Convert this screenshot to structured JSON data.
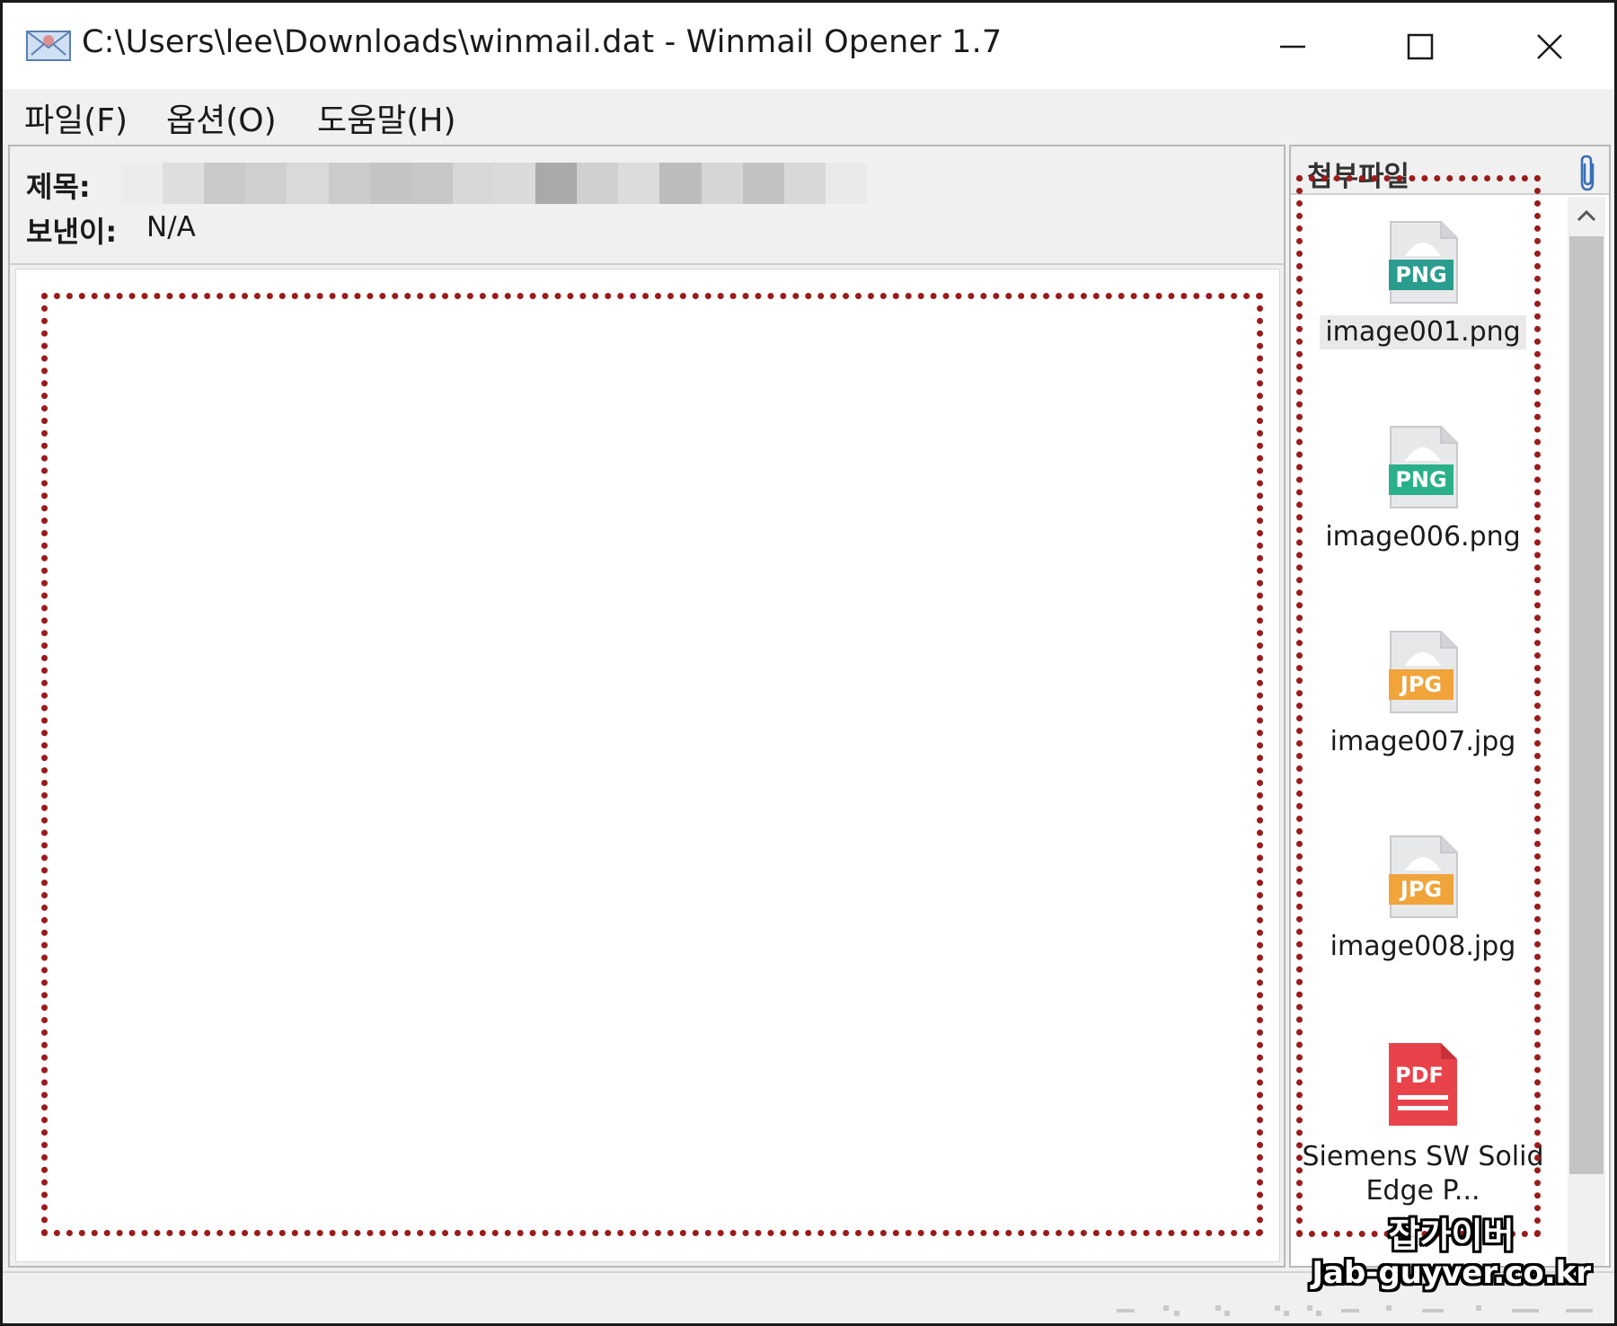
{
  "window": {
    "title": "C:\\Users\\lee\\Downloads\\winmail.dat - Winmail Opener 1.7",
    "minimize_icon": "minimize-icon",
    "maximize_icon": "maximize-icon",
    "close_icon": "close-icon"
  },
  "menu": {
    "file": "파일(F)",
    "options": "옵션(O)",
    "help": "도움말(H)"
  },
  "message": {
    "subject_label": "제목:",
    "subject_value": "",
    "sender_label": "보낸이:",
    "sender_value": "N/A"
  },
  "attachments": {
    "title": "첨부파일",
    "icon": "paperclip-icon",
    "items": [
      {
        "name": "image001.png",
        "type": "PNG",
        "color": "#2a9d8f"
      },
      {
        "name": "image006.png",
        "type": "PNG",
        "color": "#2ab08a"
      },
      {
        "name": "image007.jpg",
        "type": "JPG",
        "color": "#f0a43a"
      },
      {
        "name": "image008.jpg",
        "type": "JPG",
        "color": "#f0a43a"
      },
      {
        "name": "Siemens SW Solid Edge P...",
        "type": "PDF",
        "color": "#e8434b"
      }
    ]
  },
  "highlight_color": "#9b1b1b",
  "watermark": {
    "line1": "잡가이버",
    "line2": "Jab-guyver.co.kr"
  }
}
